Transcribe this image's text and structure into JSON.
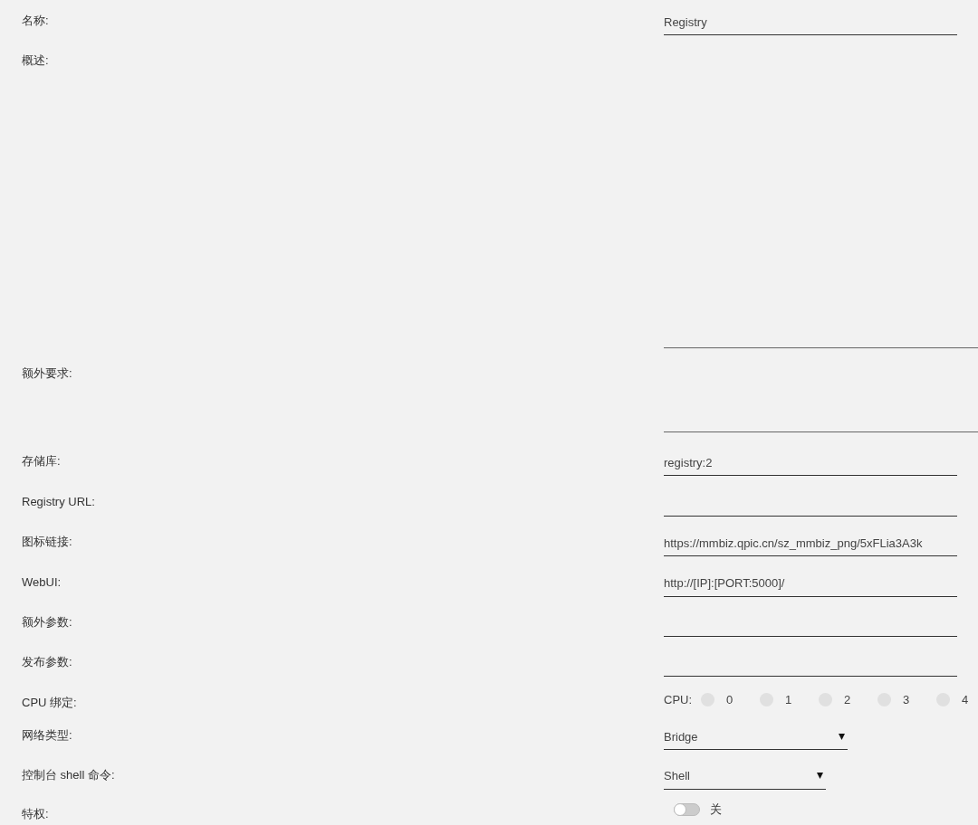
{
  "fields": [
    {
      "kind": "text",
      "label": "名称:",
      "value": "Registry"
    },
    {
      "kind": "editor",
      "label": "概述:"
    },
    {
      "kind": "textarea",
      "label": "额外要求:"
    },
    {
      "kind": "text",
      "label": "存储库:",
      "value": "registry:2"
    },
    {
      "kind": "text",
      "label": "Registry URL:"
    },
    {
      "kind": "text",
      "label": "图标链接:",
      "value": "https://mmbiz.qpic.cn/sz_mmbiz_png/5xFLia3A3k"
    },
    {
      "kind": "text",
      "label": "WebUI:",
      "value": "http://[IP]:[PORT:5000]/"
    },
    {
      "kind": "text",
      "label": "额外参数:"
    },
    {
      "kind": "text",
      "label": "发布参数:"
    },
    {
      "kind": "cpus",
      "label": "CPU 绑定:",
      "prefix": "CPU:",
      "options": [
        {
          "label": "0",
          "checked": false
        },
        {
          "label": "1",
          "checked": false
        },
        {
          "label": "2",
          "checked": false
        },
        {
          "label": "3",
          "checked": false
        },
        {
          "label": "4",
          "checked": false
        }
      ]
    },
    {
      "kind": "select",
      "label": "网络类型:",
      "value": "Bridge"
    },
    {
      "kind": "select",
      "label": "控制台 shell 命令:",
      "value": "Shell"
    },
    {
      "kind": "toggle",
      "label": "特权:",
      "on": false,
      "status_text": "关"
    }
  ]
}
